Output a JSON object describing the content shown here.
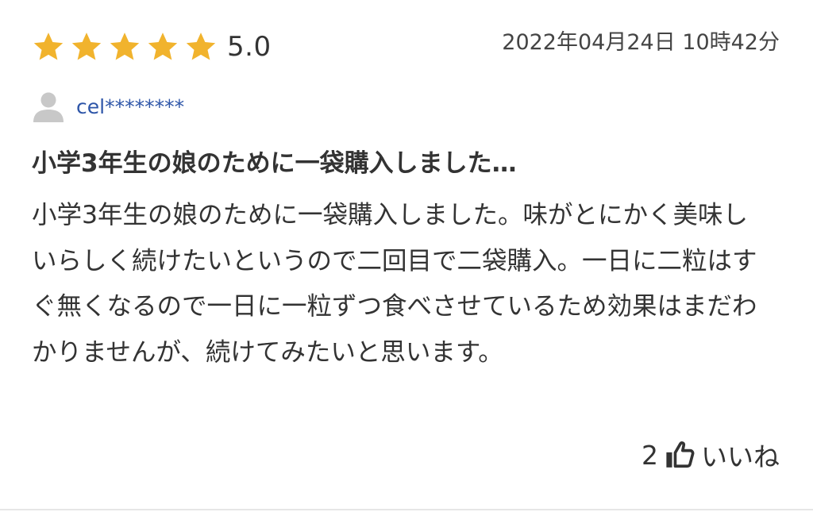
{
  "review": {
    "rating": {
      "stars": 5,
      "max_stars": 5,
      "score_text": "5.0",
      "star_color": "#f1b32d"
    },
    "date": "2022年04月24日 10時42分",
    "user": {
      "name": "cel********",
      "avatar_icon": "user-silhouette-icon",
      "name_color": "#2d55a8"
    },
    "title": "小学3年生の娘のために一袋購入しました…",
    "body": "小学3年生の娘のために一袋購入しました。味がとにかく美味しいらしく続けたいというので二回目で二袋購入。一日に二粒はすぐ無くなるので一日に一粒ずつ食べさせているため効果はまだわかりませんが、続けてみたいと思います。",
    "like": {
      "count": "2",
      "icon": "thumbs-up-icon",
      "label": "いいね"
    }
  }
}
